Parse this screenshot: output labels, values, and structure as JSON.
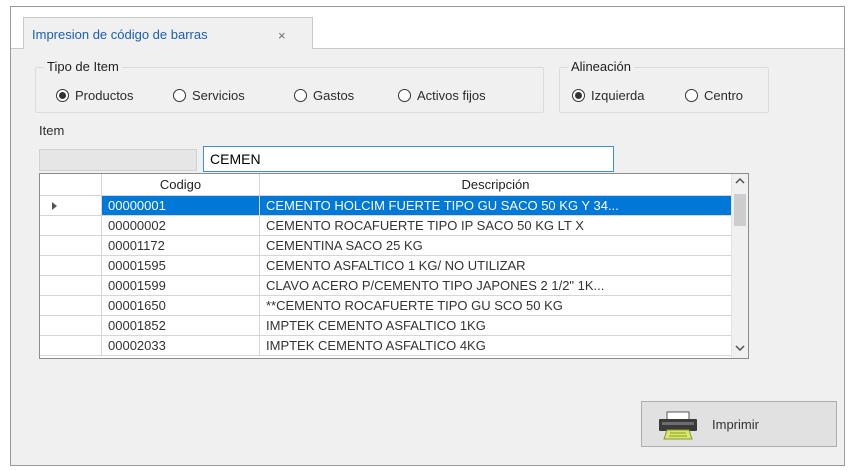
{
  "tab": {
    "title": "Impresion de código de barras",
    "close": "×"
  },
  "tipo": {
    "legend": "Tipo de Item",
    "options": [
      "Productos",
      "Servicios",
      "Gastos",
      "Activos fijos"
    ],
    "selected": "Productos"
  },
  "alineacion": {
    "legend": "Alineación",
    "options": [
      "Izquierda",
      "Centro"
    ],
    "selected": "Izquierda"
  },
  "item_label": "Item",
  "search": {
    "value": "CEMEN"
  },
  "grid": {
    "columns": [
      "Codigo",
      "Descripción"
    ],
    "rows": [
      {
        "codigo": "00000001",
        "descripcion": "CEMENTO HOLCIM FUERTE TIPO GU SACO 50 KG Y 34..."
      },
      {
        "codigo": "00000002",
        "descripcion": "CEMENTO ROCAFUERTE TIPO IP SACO 50 KG LT X"
      },
      {
        "codigo": "00001172",
        "descripcion": "CEMENTINA SACO 25 KG"
      },
      {
        "codigo": "00001595",
        "descripcion": "CEMENTO ASFALTICO 1 KG/ NO UTILIZAR"
      },
      {
        "codigo": "00001599",
        "descripcion": "CLAVO ACERO P/CEMENTO TIPO JAPONES 2 1/2\"  1K..."
      },
      {
        "codigo": "00001650",
        "descripcion": "**CEMENTO ROCAFUERTE TIPO GU SCO 50 KG"
      },
      {
        "codigo": "00001852",
        "descripcion": "IMPTEK CEMENTO ASFALTICO 1KG"
      },
      {
        "codigo": "00002033",
        "descripcion": "IMPTEK CEMENTO ASFALTICO 4KG"
      }
    ],
    "selected_index": 0
  },
  "scroll": {
    "up": "^",
    "down": "v"
  },
  "print_button": {
    "label": "Imprimir",
    "icon": "printer-icon"
  },
  "colors": {
    "selection": "#0078d7",
    "tab_text": "#1a5fb4",
    "focus_border": "#3d8fd8"
  }
}
